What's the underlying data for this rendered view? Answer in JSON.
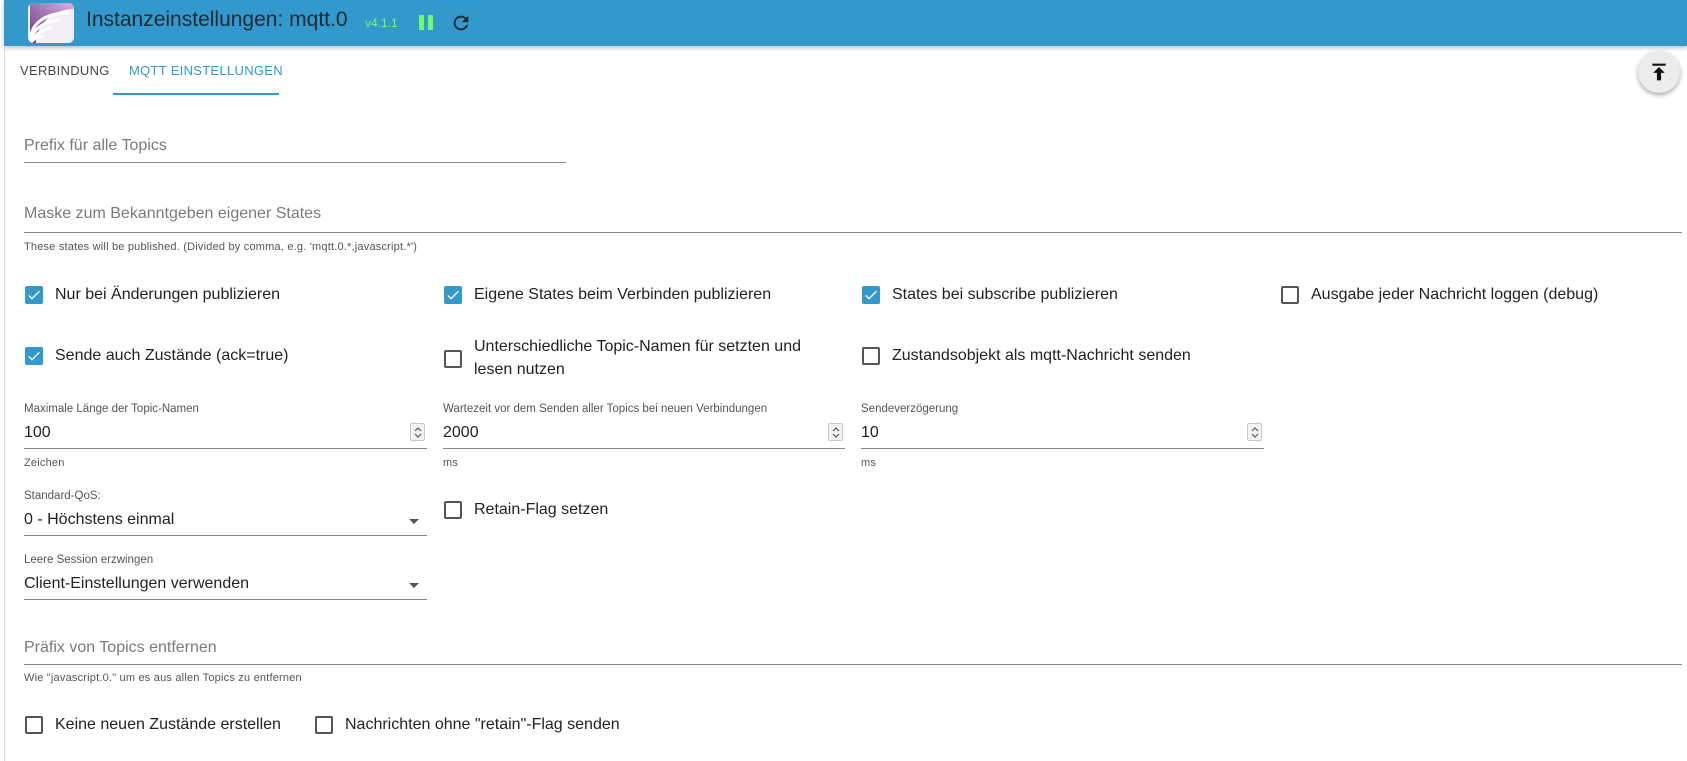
{
  "header": {
    "title": "Instanzeinstellungen: mqtt.0",
    "version": "v4.1.1",
    "background_color": "#3399cc",
    "icons": [
      "mqtt-logo-icon",
      "pause-icon",
      "reload-icon"
    ]
  },
  "tabs": [
    {
      "label": "VERBINDUNG",
      "active": false
    },
    {
      "label": "MQTT EINSTELLUNGEN",
      "active": true
    }
  ],
  "fab_icon": "scroll-to-top-icon",
  "fields": {
    "prefix": {
      "label": "Prefix für alle Topics",
      "value": ""
    },
    "mask": {
      "label": "Maske zum Bekanntgeben eigener States",
      "helper": "These states will be published. (Divided by comma, e.g. 'mqtt.0.*,javascript.*')",
      "value": ""
    },
    "max_topic_length": {
      "label": "Maximale Länge der Topic-Namen",
      "value": "100",
      "unit": "Zeichen"
    },
    "wait_time": {
      "label": "Wartezeit vor dem Senden aller Topics bei neuen Verbindungen",
      "value": "2000",
      "unit": "ms"
    },
    "send_delay": {
      "label": "Sendeverzögerung",
      "value": "10",
      "unit": "ms"
    },
    "qos": {
      "label": "Standard-QoS:",
      "value": "0 - Höchstens einmal"
    },
    "clean_session": {
      "label": "Leere Session erzwingen",
      "value": "Client-Einstellungen verwenden"
    },
    "remove_prefix": {
      "label": "Präfix von Topics entfernen",
      "helper": "Wie \"javascript.0.\" um es aus allen Topics zu entfernen",
      "value": ""
    }
  },
  "checkboxes": {
    "only_changes": {
      "label": "Nur bei Änderungen publizieren",
      "checked": true
    },
    "publish_own_on_connect": {
      "label": "Eigene States beim Verbinden publizieren",
      "checked": true
    },
    "publish_on_subscribe": {
      "label": "States bei subscribe publizieren",
      "checked": true
    },
    "debug_log": {
      "label": "Ausgabe jeder Nachricht loggen (debug)",
      "checked": false
    },
    "send_ack": {
      "label": "Sende auch Zustände (ack=true)",
      "checked": true
    },
    "different_topic_names_line1": {
      "label": "Unterschiedliche Topic-Namen für setzten und",
      "checked": false
    },
    "different_topic_names_line2": {
      "label": "lesen nutzen"
    },
    "state_object": {
      "label": "Zustandsobjekt als mqtt-Nachricht senden",
      "checked": false
    },
    "retain_flag": {
      "label": "Retain-Flag setzen",
      "checked": false
    },
    "no_new_states": {
      "label": "Keine neuen Zustände erstellen",
      "checked": false
    },
    "no_retain": {
      "label": "Nachrichten ohne \"retain\"-Flag senden",
      "checked": false
    }
  }
}
